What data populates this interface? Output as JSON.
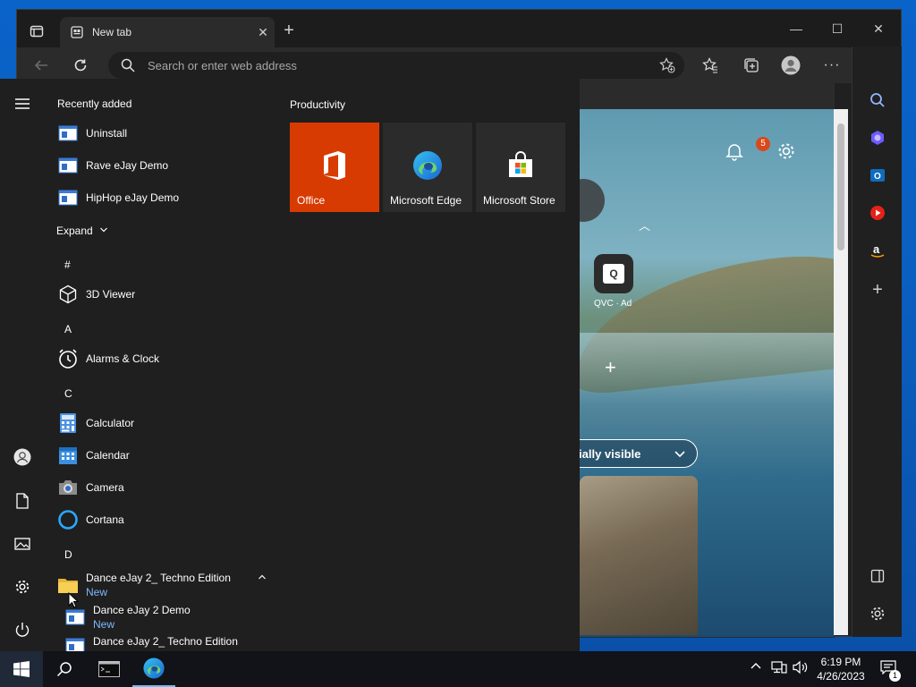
{
  "browser": {
    "tab_title": "New tab",
    "address_placeholder": "Search or enter web address"
  },
  "newtab": {
    "notification_count": "5",
    "qvc_label": "QVC · Ad",
    "qvc_icon_text": "Q",
    "feed_selector": "ially visible"
  },
  "start_menu": {
    "recently_added_title": "Recently added",
    "recent": [
      {
        "label": "Uninstall"
      },
      {
        "label": "Rave eJay Demo"
      },
      {
        "label": "HipHop eJay Demo"
      }
    ],
    "expand_label": "Expand",
    "letters": [
      "#",
      "A",
      "C",
      "D"
    ],
    "apps": [
      {
        "label": "3D Viewer"
      },
      {
        "label": "Alarms & Clock"
      },
      {
        "label": "Calculator"
      },
      {
        "label": "Calendar"
      },
      {
        "label": "Camera"
      },
      {
        "label": "Cortana"
      }
    ],
    "d_items": [
      {
        "label": "Dance eJay 2_ Techno Edition",
        "tag": "New"
      },
      {
        "label": "Dance eJay 2 Demo",
        "tag": "New"
      },
      {
        "label": "Dance eJay 2_ Techno Edition"
      }
    ],
    "tiles_title": "Productivity",
    "tiles": [
      {
        "label": "Office",
        "color": "#d83b01"
      },
      {
        "label": "Microsoft Edge",
        "color": "#2b2b2b"
      },
      {
        "label": "Microsoft Store",
        "color": "#2b2b2b"
      }
    ]
  },
  "taskbar": {
    "time": "6:19 PM",
    "date": "4/26/2023",
    "notification_count": "1"
  }
}
